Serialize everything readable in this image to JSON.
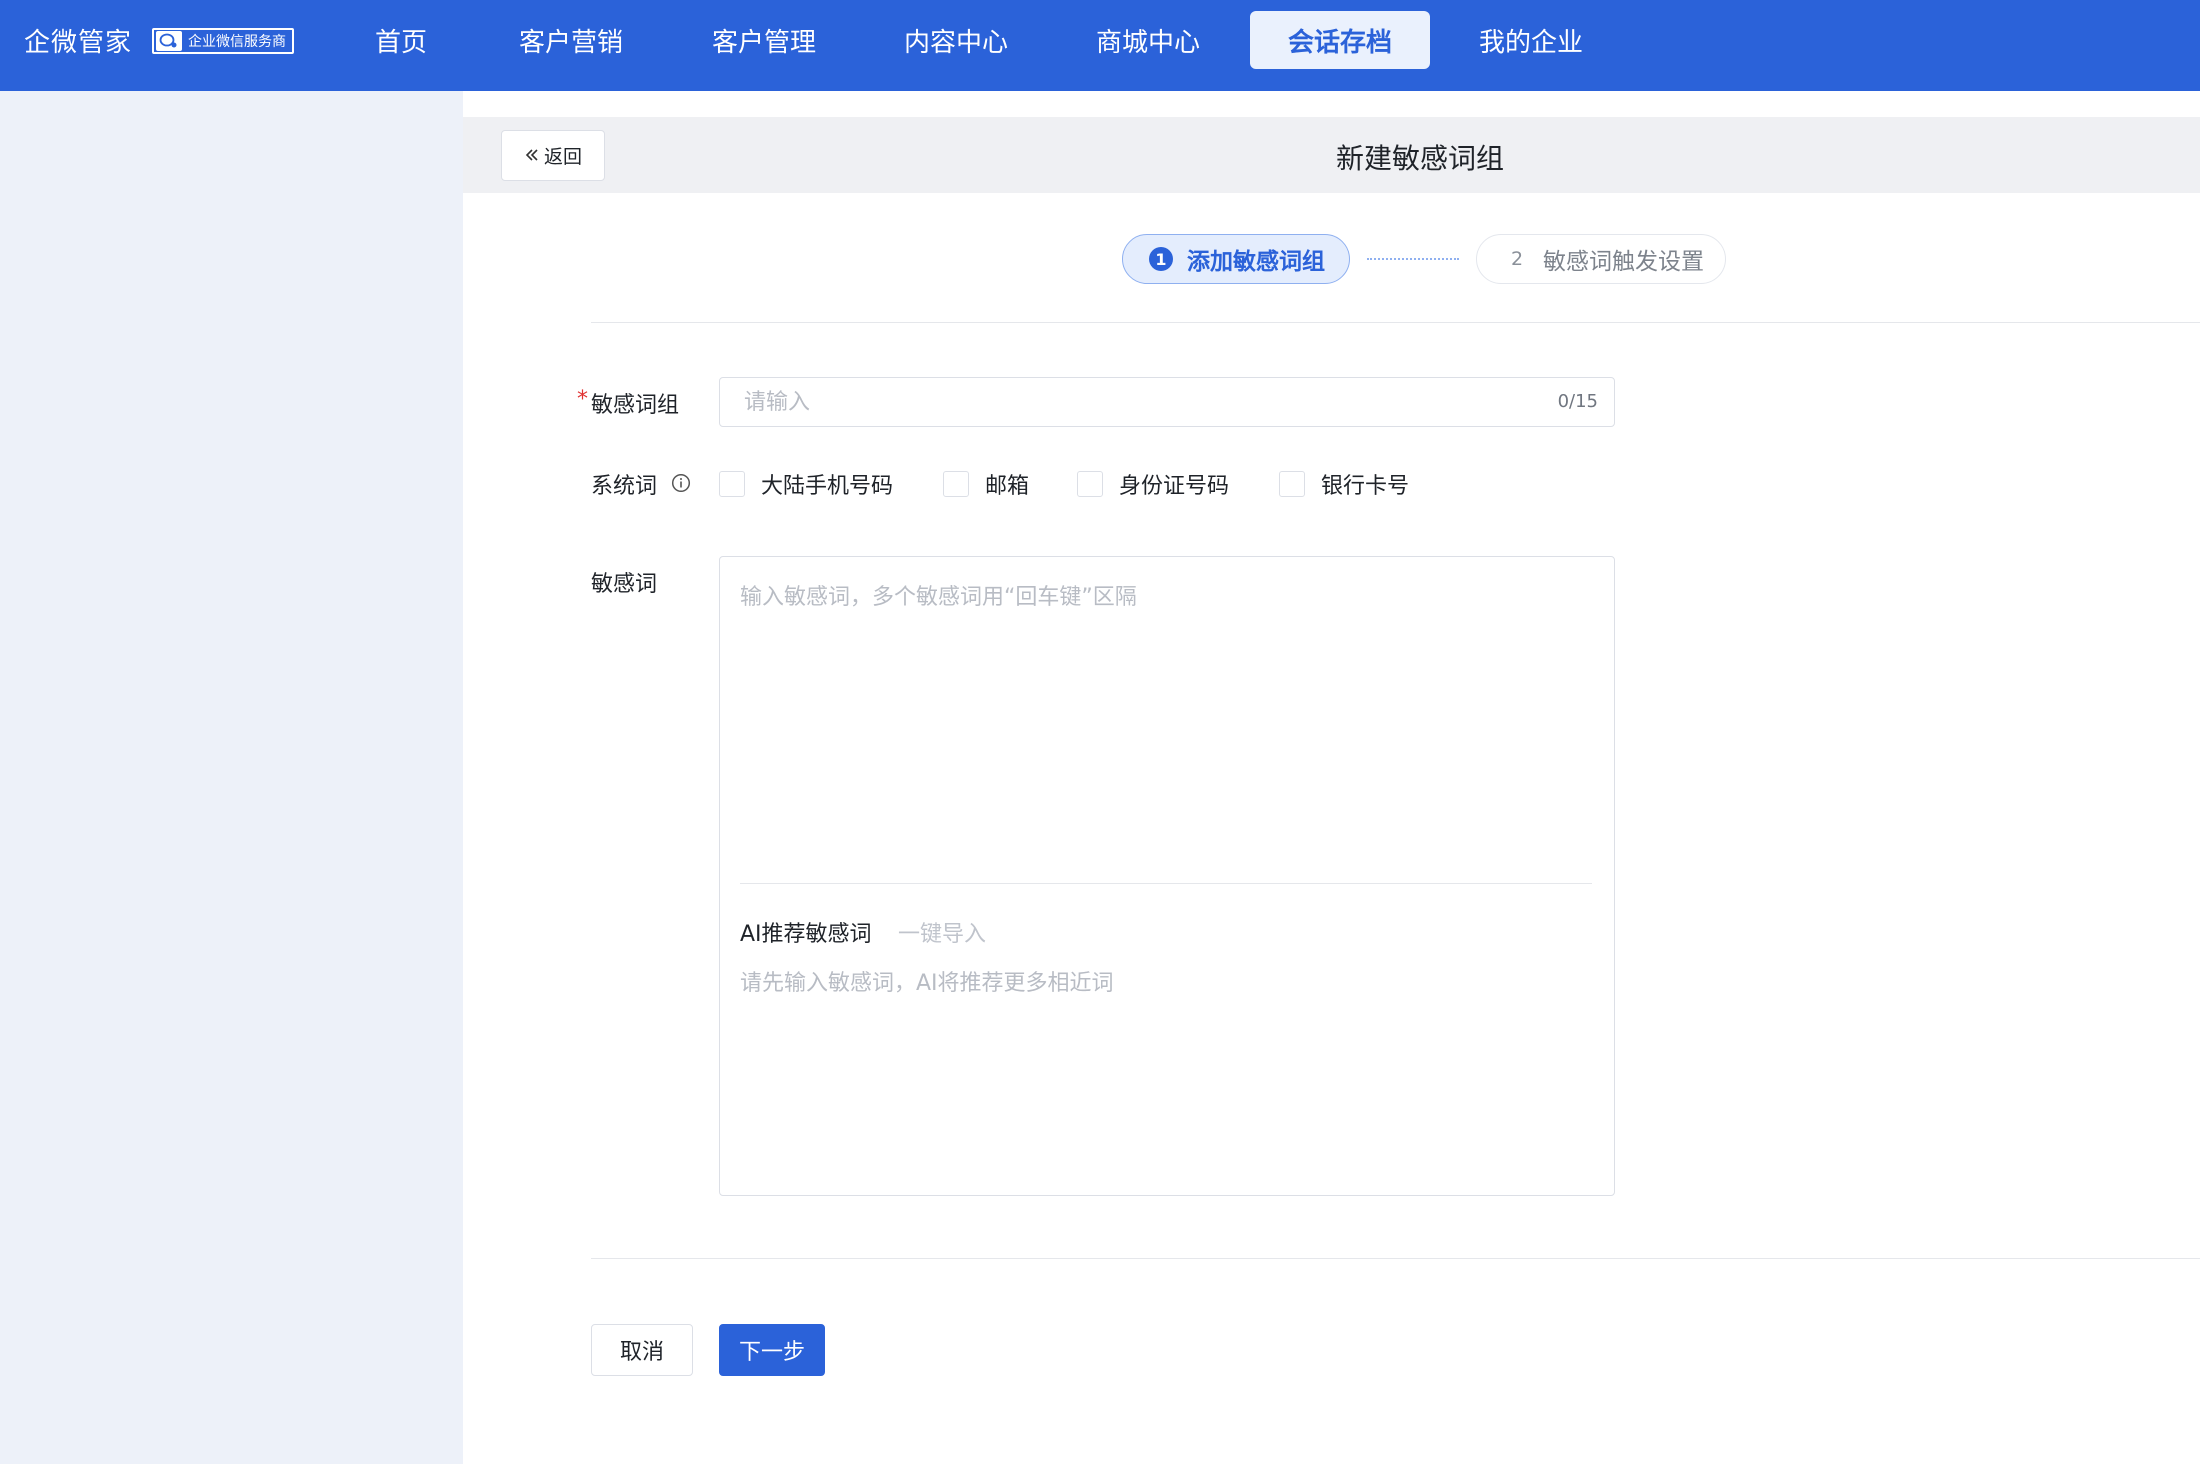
{
  "brand": {
    "name": "企微管家",
    "badge": "企业微信服务商"
  },
  "nav": {
    "items": [
      {
        "label": "首页"
      },
      {
        "label": "客户营销"
      },
      {
        "label": "客户管理"
      },
      {
        "label": "内容中心"
      },
      {
        "label": "商城中心"
      },
      {
        "label": "会话存档",
        "active": true
      },
      {
        "label": "我的企业"
      }
    ]
  },
  "header": {
    "back_label": "返回",
    "title": "新建敏感词组"
  },
  "steps": [
    {
      "num": "1",
      "label": "添加敏感词组",
      "active": true
    },
    {
      "num": "2",
      "label": "敏感词触发设置",
      "active": false
    }
  ],
  "form": {
    "group": {
      "label": "敏感词组",
      "required_mark": "*",
      "placeholder": "请输入",
      "value": "",
      "counter": "0/15"
    },
    "system_words": {
      "label": "系统词",
      "options": [
        {
          "label": "大陆手机号码",
          "checked": false
        },
        {
          "label": "邮箱",
          "checked": false
        },
        {
          "label": "身份证号码",
          "checked": false
        },
        {
          "label": "银行卡号",
          "checked": false
        }
      ]
    },
    "words": {
      "label": "敏感词",
      "placeholder": "输入敏感词，多个敏感词用“回车键”区隔",
      "value": "",
      "ai_title": "AI推荐敏感词",
      "ai_import": "一键导入",
      "ai_hint": "请先输入敏感词，AI将推荐更多相近词"
    }
  },
  "actions": {
    "cancel": "取消",
    "next": "下一步"
  },
  "colors": {
    "primary": "#2b62d9",
    "nav_active_bg": "#eaf1fd",
    "sidebar_bg": "#edf1f9",
    "required": "#e03131"
  }
}
